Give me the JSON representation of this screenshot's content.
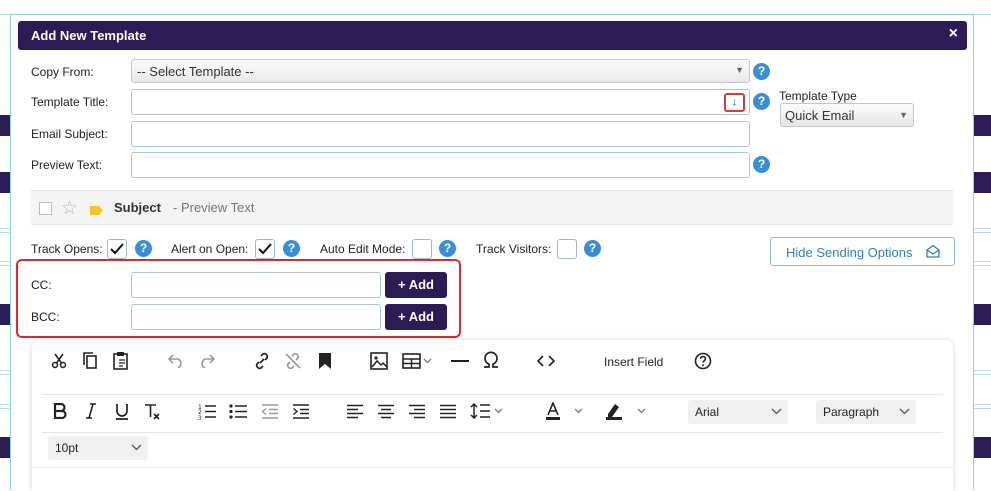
{
  "modal": {
    "title": "Add New Template",
    "close_label": "×"
  },
  "form": {
    "copy_from": {
      "label": "Copy From:",
      "selected": "-- Select Template --"
    },
    "template_title": {
      "label": "Template Title:",
      "value": ""
    },
    "email_subject": {
      "label": "Email Subject:",
      "value": ""
    },
    "preview_text": {
      "label": "Preview Text:",
      "value": ""
    },
    "template_type": {
      "label": "Template Type",
      "selected": "Quick Email"
    },
    "help_label": "?"
  },
  "preview_row": {
    "subject": "Subject",
    "preview": "- Preview Text"
  },
  "options": {
    "track_opens": {
      "label": "Track Opens:",
      "checked": true
    },
    "alert_on_open": {
      "label": "Alert on Open:",
      "checked": true
    },
    "auto_edit_mode": {
      "label": "Auto Edit Mode:",
      "checked": false
    },
    "track_visitors": {
      "label": "Track Visitors:",
      "checked": false
    },
    "hide_sending_options": "Hide Sending Options"
  },
  "recipients": {
    "cc_label": "CC:",
    "bcc_label": "BCC:",
    "add_label": "+ Add"
  },
  "editor": {
    "insert_field": "Insert Field",
    "font_family": "Arial",
    "block_format": "Paragraph",
    "font_size": "10pt"
  },
  "colors": {
    "header_bg": "#2d1b55",
    "accent_blue": "#3a8fd3",
    "highlight_red": "#e0282f"
  }
}
